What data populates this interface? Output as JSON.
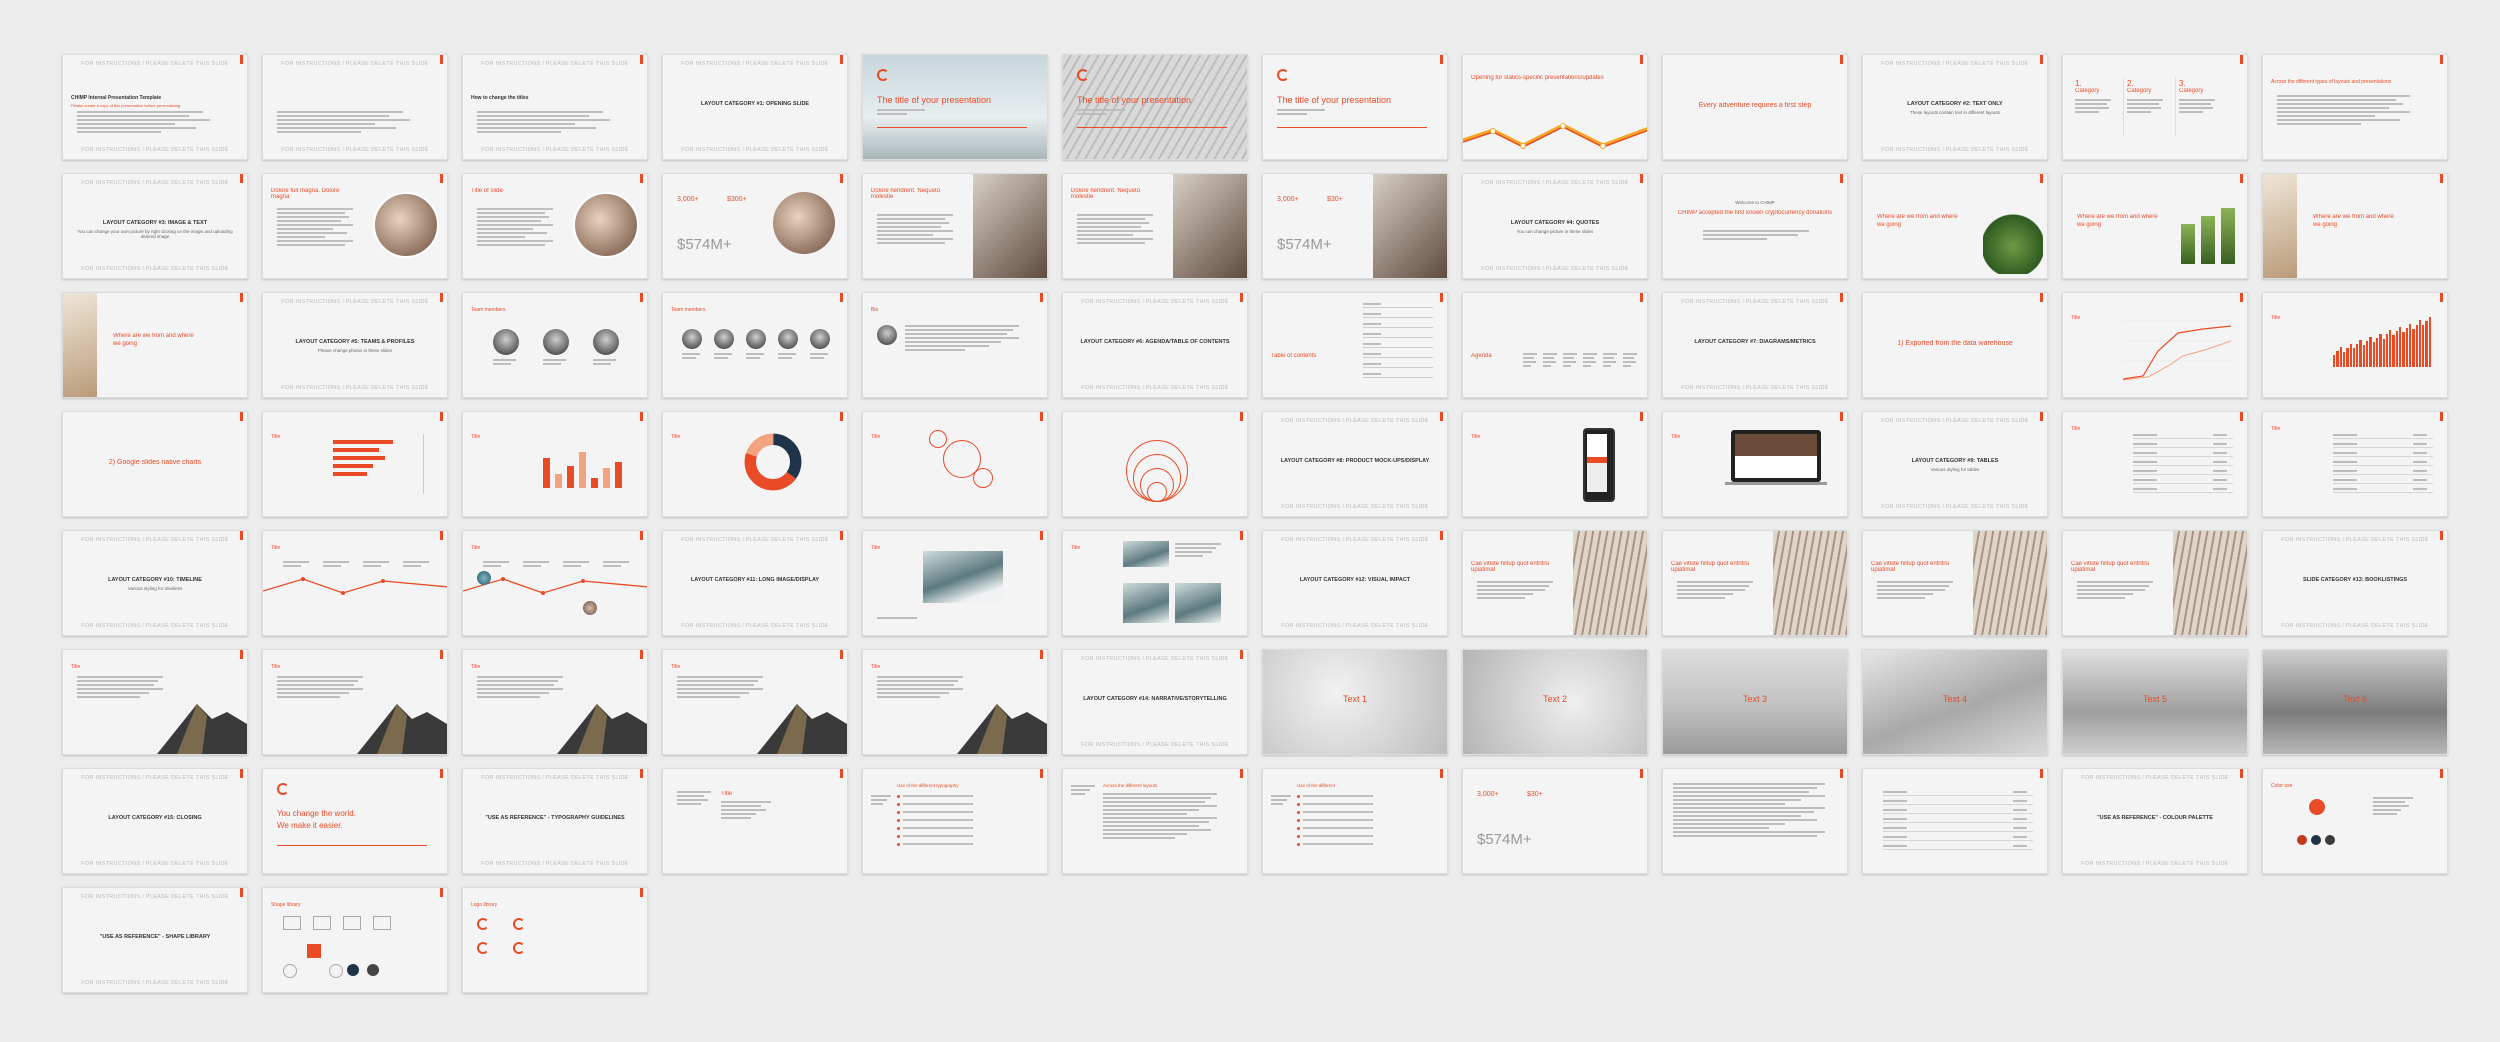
{
  "colors": {
    "accent": "#e84b26",
    "slide_bg": "#f4f4f5",
    "page_bg": "#ececec",
    "navy": "#1f3449"
  },
  "slides": [
    {
      "k": "instr",
      "top": "FOR INSTRUCTIONS / PLEASE DELETE THIS SLIDE",
      "bottom": "FOR INSTRUCTIONS / PLEASE DELETE THIS SLIDE",
      "title": "CHIMP Internal Presentation Template",
      "note": "Please create a copy of this presentation before personalising"
    },
    {
      "k": "instr",
      "top": "FOR INSTRUCTIONS / PLEASE DELETE THIS SLIDE",
      "bottom": "FOR INSTRUCTIONS / PLEASE DELETE THIS SLIDE"
    },
    {
      "k": "instr",
      "top": "FOR INSTRUCTIONS / PLEASE DELETE THIS SLIDE",
      "bottom": "FOR INSTRUCTIONS / PLEASE DELETE THIS SLIDE",
      "title": "How to change the titles"
    },
    {
      "k": "title",
      "top": "FOR INSTRUCTIONS / PLEASE DELETE THIS SLIDE",
      "bottom": "FOR INSTRUCTIONS / PLEASE DELETE THIS SLIDE",
      "title": "LAYOUT CATEGORY #1: OPENING SLIDE"
    },
    {
      "k": "cover",
      "photo": "sky",
      "title": "The title of your presentation"
    },
    {
      "k": "cover",
      "photo": "arch",
      "title": "The title of your presentation"
    },
    {
      "k": "cover",
      "photo": "none",
      "title": "The title of your presentation"
    },
    {
      "k": "zigzag",
      "title": "Opening for statics-specific presentations/updates"
    },
    {
      "k": "center",
      "title": "Every adventure requires a first step"
    },
    {
      "k": "title",
      "top": "FOR INSTRUCTIONS / PLEASE DELETE THIS SLIDE",
      "bottom": "FOR INSTRUCTIONS / PLEASE DELETE THIS SLIDE",
      "title": "LAYOUT CATEGORY #2: TEXT ONLY",
      "sub": "These layouts contain text in different layouts"
    },
    {
      "k": "cats",
      "labels": [
        "1.",
        "2.",
        "3."
      ],
      "cat": "Category"
    },
    {
      "k": "textonly",
      "title": "Across the different types of layouts and presentations"
    },
    {
      "k": "title",
      "top": "FOR INSTRUCTIONS / PLEASE DELETE THIS SLIDE",
      "bottom": "FOR INSTRUCTIONS / PLEASE DELETE THIS SLIDE",
      "title": "LAYOUT CATEGORY #3: IMAGE & TEXT",
      "sub": "You can change your own picture by right clicking on the image and uploading desired image"
    },
    {
      "k": "circleimg",
      "title": "Dolore fuit magna. Dolore magna"
    },
    {
      "k": "circleimg",
      "title": "Title of slide"
    },
    {
      "k": "stats",
      "vals": [
        "3,000+",
        "$300+",
        "$574M+"
      ]
    },
    {
      "k": "halfimg",
      "title": "Dolore hendrerit. Nequeto molestie"
    },
    {
      "k": "halfimg",
      "title": "Dolore hendrerit. Nequeto molestie"
    },
    {
      "k": "stats2",
      "vals": [
        "3,000+",
        "$30+",
        "$574M+"
      ]
    },
    {
      "k": "title",
      "top": "FOR INSTRUCTIONS / PLEASE DELETE THIS SLIDE",
      "bottom": "FOR INSTRUCTIONS / PLEASE DELETE THIS SLIDE",
      "title": "LAYOUT CATEGORY #4: QUOTES",
      "sub": "You can change picture in these slides"
    },
    {
      "k": "quote",
      "pre": "Welcome to CHIMP",
      "title": "CHIMP accepted the first known cryptocurrency donations"
    },
    {
      "k": "where",
      "plant": "big",
      "line1": "Where are we from and where",
      "line2": "we going"
    },
    {
      "k": "where",
      "plant": "small",
      "line1": "Where are we from and where",
      "line2": "we going"
    },
    {
      "k": "where",
      "plant": "desk",
      "line1": "Where are we from and where",
      "line2": "we going"
    },
    {
      "k": "where2",
      "line1": "Where are we from and where",
      "line2": "we going"
    },
    {
      "k": "title",
      "top": "FOR INSTRUCTIONS / PLEASE DELETE THIS SLIDE",
      "bottom": "FOR INSTRUCTIONS / PLEASE DELETE THIS SLIDE",
      "title": "LAYOUT CATEGORY #5: TEAMS & PROFILES",
      "sub": "Please change photos in these slides"
    },
    {
      "k": "team",
      "title": "Team members",
      "n": 3
    },
    {
      "k": "team",
      "title": "Team members",
      "n": 5
    },
    {
      "k": "profile",
      "title": "Bio"
    },
    {
      "k": "title",
      "top": "FOR INSTRUCTIONS / PLEASE DELETE THIS SLIDE",
      "bottom": "FOR INSTRUCTIONS / PLEASE DELETE THIS SLIDE",
      "title": "LAYOUT CATEGORY #6: AGENDA/TABLE OF CONTENTS"
    },
    {
      "k": "toc",
      "title": "Table of contents"
    },
    {
      "k": "agenda",
      "title": "Agenda"
    },
    {
      "k": "title",
      "top": "FOR INSTRUCTIONS / PLEASE DELETE THIS SLIDE",
      "bottom": "FOR INSTRUCTIONS / PLEASE DELETE THIS SLIDE",
      "title": "LAYOUT CATEGORY #7: DIAGRAMS/METRICS"
    },
    {
      "k": "center",
      "title": "1) Exported from the data warehouse"
    },
    {
      "k": "linechart",
      "title": "Title"
    },
    {
      "k": "barchart",
      "title": "Title"
    },
    {
      "k": "center",
      "title": "2) Google slides native charts"
    },
    {
      "k": "hbar",
      "title": "Title"
    },
    {
      "k": "vbar",
      "title": "Title"
    },
    {
      "k": "donut",
      "title": "Title"
    },
    {
      "k": "bubbles",
      "title": "Title"
    },
    {
      "k": "rings",
      "title": ""
    },
    {
      "k": "title",
      "top": "FOR INSTRUCTIONS / PLEASE DELETE THIS SLIDE",
      "bottom": "FOR INSTRUCTIONS / PLEASE DELETE THIS SLIDE",
      "title": "LAYOUT CATEGORY #8: PRODUCT MOCK-UPS/DISPLAY"
    },
    {
      "k": "phone",
      "title": "Title"
    },
    {
      "k": "laptop",
      "title": "Title"
    },
    {
      "k": "title",
      "top": "FOR INSTRUCTIONS / PLEASE DELETE THIS SLIDE",
      "bottom": "FOR INSTRUCTIONS / PLEASE DELETE THIS SLIDE",
      "title": "LAYOUT CATEGORY #9: TABLES",
      "sub": "Various styling for tables"
    },
    {
      "k": "table",
      "title": "Title"
    },
    {
      "k": "table2",
      "title": "Title"
    },
    {
      "k": "title",
      "top": "FOR INSTRUCTIONS / PLEASE DELETE THIS SLIDE",
      "bottom": "FOR INSTRUCTIONS / PLEASE DELETE THIS SLIDE",
      "title": "LAYOUT CATEGORY #10: TIMELINE",
      "sub": "Various styling for timelines"
    },
    {
      "k": "timeline",
      "title": "Title"
    },
    {
      "k": "timeline2",
      "title": "Title"
    },
    {
      "k": "title",
      "top": "FOR INSTRUCTIONS / PLEASE DELETE THIS SLIDE",
      "bottom": "FOR INSTRUCTIONS / PLEASE DELETE THIS SLIDE",
      "title": "LAYOUT CATEGORY #11: LONG IMAGE/DISPLAY"
    },
    {
      "k": "mountain1",
      "title": "Title"
    },
    {
      "k": "mountain3",
      "title": "Title"
    },
    {
      "k": "title",
      "top": "FOR INSTRUCTIONS / PLEASE DELETE THIS SLIDE",
      "bottom": "FOR INSTRUCTIONS / PLEASE DELETE THIS SLIDE",
      "title": "LAYOUT CATEGORY #12: VISUAL IMPACT"
    },
    {
      "k": "arch",
      "title": "Cae vitiste hiltup quot enfritisi upiatimal"
    },
    {
      "k": "arch",
      "title": "Cae vitiste hiltup quot enfritisi upiatimal"
    },
    {
      "k": "arch",
      "title": "Cae vitiste hiltup quot enfritisi upiatimal"
    },
    {
      "k": "arch",
      "title": "Cae vitiste hiltup quot enfritisi upiatimal"
    },
    {
      "k": "title",
      "top": "FOR INSTRUCTIONS / PLEASE DELETE THIS SLIDE",
      "bottom": "FOR INSTRUCTIONS / PLEASE DELETE THIS SLIDE",
      "title": "SLIDE CATEGORY #13: BOOKLISTINGS"
    },
    {
      "k": "peak",
      "title": "Title"
    },
    {
      "k": "peak",
      "title": "Title"
    },
    {
      "k": "peak",
      "title": "Title"
    },
    {
      "k": "peak",
      "title": "Title"
    },
    {
      "k": "peak",
      "title": "Title"
    },
    {
      "k": "title",
      "top": "FOR INSTRUCTIONS / PLEASE DELETE THIS SLIDE",
      "bottom": "FOR INSTRUCTIONS / PLEASE DELETE THIS SLIDE",
      "title": "LAYOUT CATEGORY #14: NARRATIVE/STORYTELLING"
    },
    {
      "k": "textbg",
      "bg": "cloud",
      "title": "Text 1"
    },
    {
      "k": "textbg",
      "bg": "cloud2",
      "title": "Text 2"
    },
    {
      "k": "textbg",
      "bg": "cloud3",
      "title": "Text 3"
    },
    {
      "k": "textbg",
      "bg": "snow",
      "title": "Text 4"
    },
    {
      "k": "textbg",
      "bg": "snow2",
      "title": "Text 5"
    },
    {
      "k": "textbg",
      "bg": "snow3",
      "title": "Text 6"
    },
    {
      "k": "title",
      "top": "FOR INSTRUCTIONS / PLEASE DELETE THIS SLIDE",
      "bottom": "FOR INSTRUCTIONS / PLEASE DELETE THIS SLIDE",
      "title": "LAYOUT CATEGORY #15: CLOSING"
    },
    {
      "k": "closing",
      "line1": "You change the world.",
      "line2": "We make it easier."
    },
    {
      "k": "title",
      "top": "FOR INSTRUCTIONS / PLEASE DELETE THIS SLIDE",
      "bottom": "FOR INSTRUCTIONS / PLEASE DELETE THIS SLIDE",
      "title": "\"USE AS REFERENCE\" - TYPOGRAPHY GUIDELINES"
    },
    {
      "k": "typo",
      "title": "Title"
    },
    {
      "k": "list",
      "title": "Use of the different typography"
    },
    {
      "k": "cols",
      "title": "Across the different layouts"
    },
    {
      "k": "list2",
      "title": "Use of the different"
    },
    {
      "k": "stats3",
      "vals": [
        "3,000+",
        "$30+",
        "$574M+"
      ]
    },
    {
      "k": "text2",
      "title": ""
    },
    {
      "k": "table3",
      "title": ""
    },
    {
      "k": "title",
      "top": "FOR INSTRUCTIONS / PLEASE DELETE THIS SLIDE",
      "bottom": "FOR INSTRUCTIONS / PLEASE DELETE THIS SLIDE",
      "title": "\"USE AS REFERENCE\" - COLOUR PALETTE"
    },
    {
      "k": "palette",
      "title": "Color use"
    },
    {
      "k": "title",
      "top": "FOR INSTRUCTIONS / PLEASE DELETE THIS SLIDE",
      "bottom": "FOR INSTRUCTIONS / PLEASE DELETE THIS SLIDE",
      "title": "\"USE AS REFERENCE\" - SHAPE LIBRARY"
    },
    {
      "k": "shapes",
      "title": "Shape library"
    },
    {
      "k": "logos",
      "title": "Logo library"
    }
  ]
}
